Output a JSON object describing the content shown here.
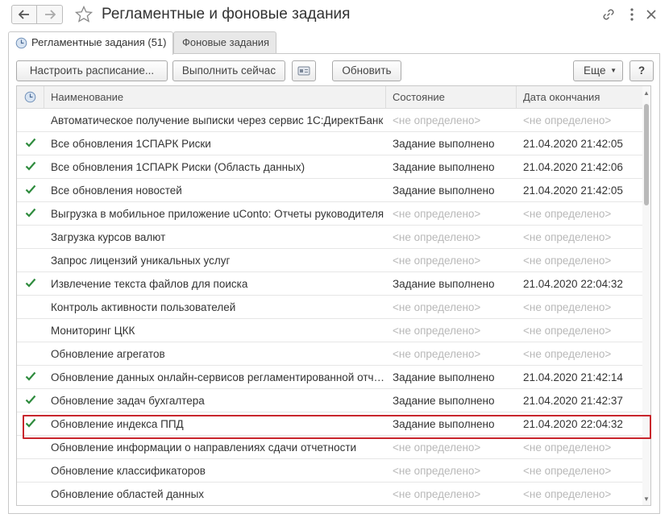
{
  "window": {
    "title": "Регламентные и фоновые задания"
  },
  "tabs": [
    {
      "label": "Регламентные задания (51)",
      "active": true
    },
    {
      "label": "Фоновые задания",
      "active": false
    }
  ],
  "toolbar": {
    "schedule_label": "Настроить расписание...",
    "run_now_label": "Выполнить сейчас",
    "refresh_label": "Обновить",
    "more_label": "Еще",
    "help_label": "?"
  },
  "table": {
    "columns": {
      "name": "Наименование",
      "state": "Состояние",
      "end_date": "Дата окончания"
    },
    "rows": [
      {
        "done": false,
        "name": "Автоматическое получение выписки через сервис 1С:ДиректБанк",
        "state": "<не определено>",
        "end_date": "<не определено>"
      },
      {
        "done": true,
        "name": "Все обновления 1СПАРК Риски",
        "state": "Задание выполнено",
        "end_date": "21.04.2020 21:42:05"
      },
      {
        "done": true,
        "name": "Все обновления 1СПАРК Риски (Область данных)",
        "state": "Задание выполнено",
        "end_date": "21.04.2020 21:42:06"
      },
      {
        "done": true,
        "name": "Все обновления новостей",
        "state": "Задание выполнено",
        "end_date": "21.04.2020 21:42:05"
      },
      {
        "done": true,
        "name": "Выгрузка в мобильное приложение uConto: Отчеты руководителя",
        "state": "<не определено>",
        "end_date": "<не определено>"
      },
      {
        "done": false,
        "name": "Загрузка курсов валют",
        "state": "<не определено>",
        "end_date": "<не определено>"
      },
      {
        "done": false,
        "name": "Запрос лицензий уникальных услуг",
        "state": "<не определено>",
        "end_date": "<не определено>"
      },
      {
        "done": true,
        "name": "Извлечение текста файлов для поиска",
        "state": "Задание выполнено",
        "end_date": "21.04.2020 22:04:32"
      },
      {
        "done": false,
        "name": "Контроль активности пользователей",
        "state": "<не определено>",
        "end_date": "<не определено>"
      },
      {
        "done": false,
        "name": "Мониторинг ЦКК",
        "state": "<не определено>",
        "end_date": "<не определено>"
      },
      {
        "done": false,
        "name": "Обновление агрегатов",
        "state": "<не определено>",
        "end_date": "<не определено>"
      },
      {
        "done": true,
        "name": "Обновление данных онлайн-сервисов регламентированной отчет...",
        "state": "Задание выполнено",
        "end_date": "21.04.2020 21:42:14"
      },
      {
        "done": true,
        "name": "Обновление задач бухгалтера",
        "state": "Задание выполнено",
        "end_date": "21.04.2020 21:42:37"
      },
      {
        "done": true,
        "name": "Обновление индекса ППД",
        "state": "Задание выполнено",
        "end_date": "21.04.2020 22:04:32",
        "highlighted": true
      },
      {
        "done": false,
        "name": "Обновление информации о направлениях сдачи отчетности",
        "state": "<не определено>",
        "end_date": "<не определено>"
      },
      {
        "done": false,
        "name": "Обновление классификаторов",
        "state": "<не определено>",
        "end_date": "<не определено>"
      },
      {
        "done": false,
        "name": "Обновление областей данных",
        "state": "<не определено>",
        "end_date": "<не определено>"
      }
    ]
  },
  "colors": {
    "check": "#2e8b3d",
    "highlight": "#c8252c",
    "muted": "#b8b8b8"
  }
}
